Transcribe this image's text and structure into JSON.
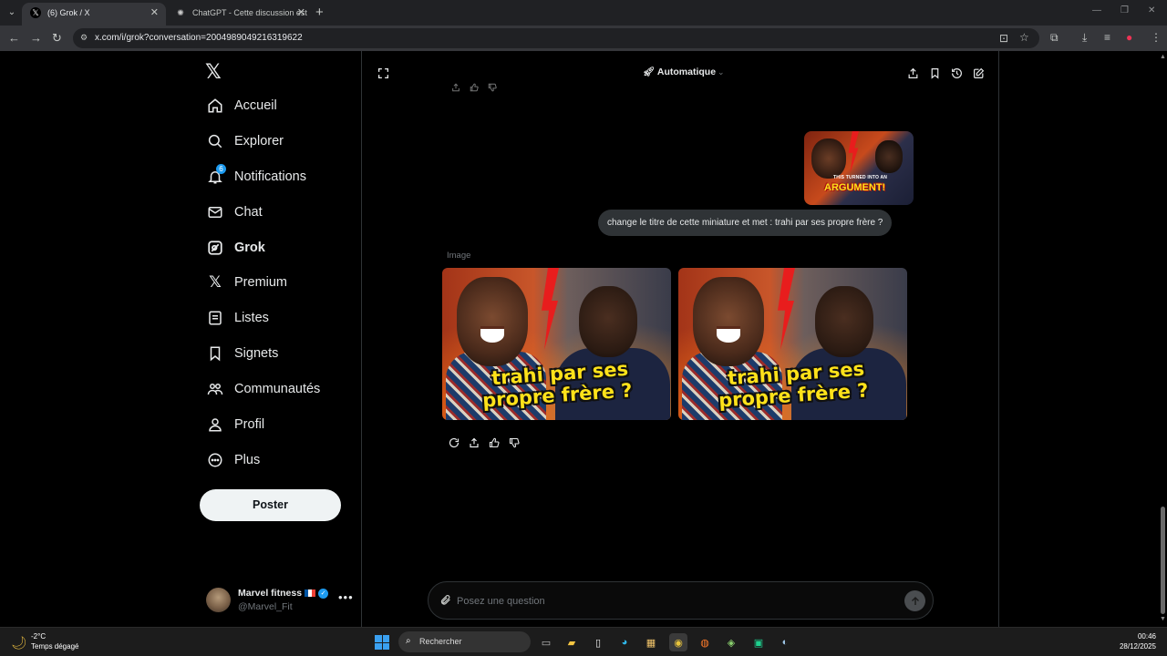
{
  "browser": {
    "tabs": [
      {
        "title": "(6) Grok / X",
        "active": true
      },
      {
        "title": "ChatGPT - Cette discussion est",
        "active": false
      }
    ],
    "url": "x.com/i/grok?conversation=2004989049216319622"
  },
  "sidebar": {
    "logo": "X",
    "items": [
      {
        "label": "Accueil",
        "icon": "home-icon"
      },
      {
        "label": "Explorer",
        "icon": "search-icon"
      },
      {
        "label": "Notifications",
        "icon": "bell-icon",
        "badge": "6"
      },
      {
        "label": "Chat",
        "icon": "mail-icon"
      },
      {
        "label": "Grok",
        "icon": "grok-icon",
        "active": true
      },
      {
        "label": "Premium",
        "icon": "x-premium-icon"
      },
      {
        "label": "Listes",
        "icon": "list-icon"
      },
      {
        "label": "Signets",
        "icon": "bookmark-icon"
      },
      {
        "label": "Communautés",
        "icon": "communities-icon"
      },
      {
        "label": "Profil",
        "icon": "profile-icon"
      },
      {
        "label": "Plus",
        "icon": "more-circle-icon"
      }
    ],
    "post_button": "Poster",
    "account": {
      "name": "Marvel fitness",
      "handle": "@Marvel_Fit"
    }
  },
  "main": {
    "mode_label": "Automatique",
    "user_image": {
      "small_caption": "THIS TURNED INTO AN",
      "big_caption": "ARGUMENT!"
    },
    "user_message": "change le titre de cette miniature et met : trahi par ses propre frère ?",
    "image_section_label": "Image",
    "generated_images": [
      {
        "line1": "trahi par ses",
        "line2": "propre frère ?"
      },
      {
        "line1": "trahi par ses",
        "line2": "propre frère ?"
      }
    ],
    "input_placeholder": "Posez une question"
  },
  "taskbar": {
    "weather_temp": "-2°C",
    "weather_desc": "Temps dégagé",
    "search_label": "Rechercher",
    "time": "00:46",
    "date": "28/12/2025"
  },
  "colors": {
    "accent": "#1d9bf0",
    "background": "#000000",
    "text": "#e7e9ea",
    "muted": "#71767b",
    "thumbnail_text": "#ffe21a"
  }
}
